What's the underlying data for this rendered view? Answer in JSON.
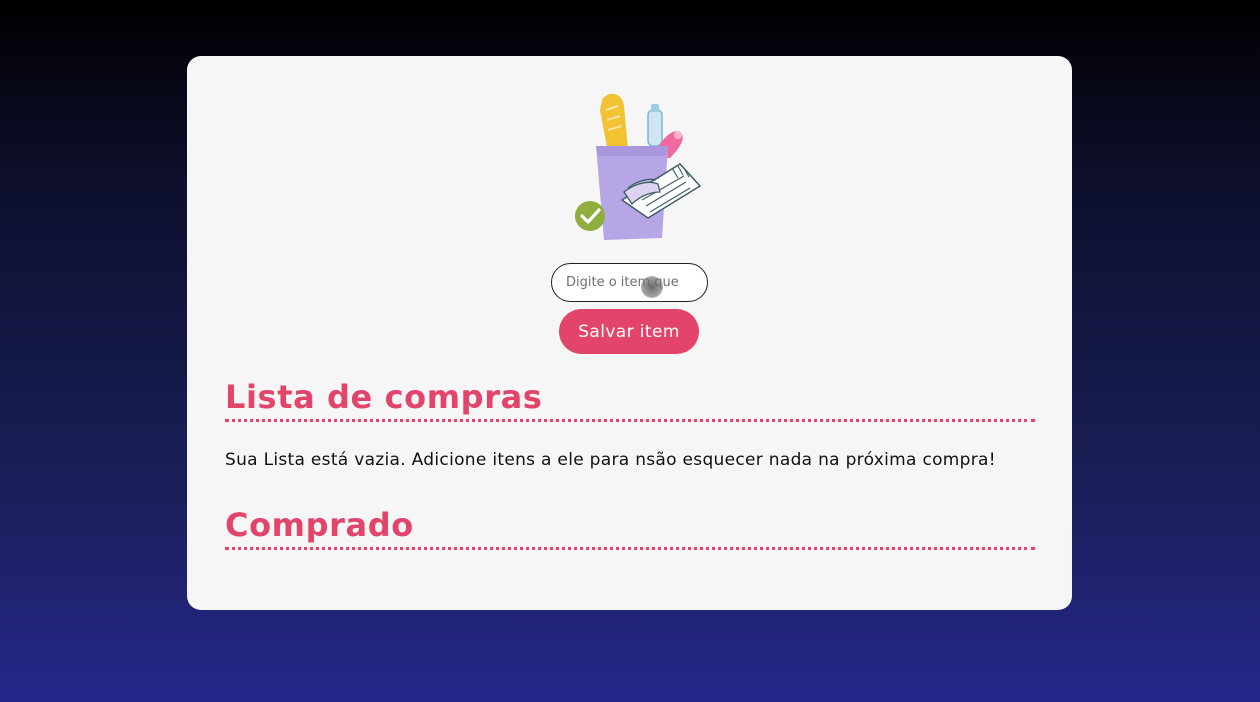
{
  "form": {
    "input_placeholder": "Digite o item que",
    "input_value": "",
    "save_label": "Salvar item"
  },
  "shopping_list": {
    "title": "Lista de compras",
    "empty_message": "Sua Lista está vazia. Adicione itens a ele para nsão esquecer nada na próxima compra!"
  },
  "bought": {
    "title": "Comprado"
  },
  "colors": {
    "accent": "#e3456a",
    "card_background": "#f6f6f6",
    "page_background_top": "#000000",
    "page_background_bottom": "#25288a"
  },
  "icons": {
    "hero": "grocery-bag-illustration",
    "check": "checkmark-icon"
  }
}
